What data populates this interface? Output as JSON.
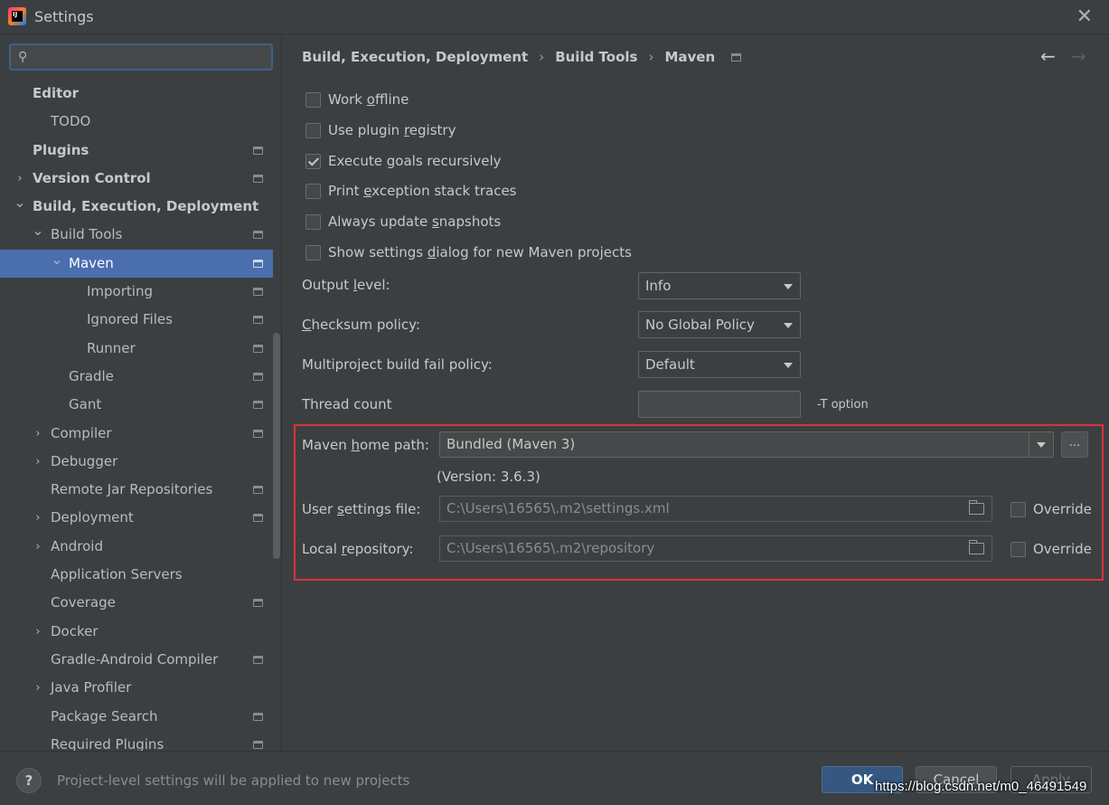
{
  "window": {
    "title": "Settings",
    "app_icon_text": "IJ",
    "close_glyph": "✕"
  },
  "search": {
    "placeholder": "",
    "icon_glyph": "⚲"
  },
  "sidebar": {
    "items": [
      {
        "label": "Editor",
        "bold": true,
        "level": 0,
        "arrow": "",
        "has_icon": false
      },
      {
        "label": "TODO",
        "bold": false,
        "level": 1,
        "arrow": "",
        "has_icon": false
      },
      {
        "label": "Plugins",
        "bold": true,
        "level": 0,
        "arrow": "",
        "has_icon": true
      },
      {
        "label": "Version Control",
        "bold": true,
        "level": 0,
        "arrow": "›",
        "has_icon": true
      },
      {
        "label": "Build, Execution, Deployment",
        "bold": true,
        "level": 0,
        "arrow": "⌄",
        "has_icon": false
      },
      {
        "label": "Build Tools",
        "bold": false,
        "level": 1,
        "arrow": "⌄",
        "has_icon": true
      },
      {
        "label": "Maven",
        "bold": false,
        "level": 2,
        "arrow": "⌄",
        "has_icon": true,
        "selected": true
      },
      {
        "label": "Importing",
        "bold": false,
        "level": 3,
        "arrow": "",
        "has_icon": true
      },
      {
        "label": "Ignored Files",
        "bold": false,
        "level": 3,
        "arrow": "",
        "has_icon": true
      },
      {
        "label": "Runner",
        "bold": false,
        "level": 3,
        "arrow": "",
        "has_icon": true
      },
      {
        "label": "Gradle",
        "bold": false,
        "level": 2,
        "arrow": "",
        "has_icon": true
      },
      {
        "label": "Gant",
        "bold": false,
        "level": 2,
        "arrow": "",
        "has_icon": true
      },
      {
        "label": "Compiler",
        "bold": false,
        "level": 1,
        "arrow": "›",
        "has_icon": true
      },
      {
        "label": "Debugger",
        "bold": false,
        "level": 1,
        "arrow": "›",
        "has_icon": false
      },
      {
        "label": "Remote Jar Repositories",
        "bold": false,
        "level": 1,
        "arrow": "",
        "has_icon": true
      },
      {
        "label": "Deployment",
        "bold": false,
        "level": 1,
        "arrow": "›",
        "has_icon": true
      },
      {
        "label": "Android",
        "bold": false,
        "level": 1,
        "arrow": "›",
        "has_icon": false
      },
      {
        "label": "Application Servers",
        "bold": false,
        "level": 1,
        "arrow": "",
        "has_icon": false
      },
      {
        "label": "Coverage",
        "bold": false,
        "level": 1,
        "arrow": "",
        "has_icon": true
      },
      {
        "label": "Docker",
        "bold": false,
        "level": 1,
        "arrow": "›",
        "has_icon": false
      },
      {
        "label": "Gradle-Android Compiler",
        "bold": false,
        "level": 1,
        "arrow": "",
        "has_icon": true
      },
      {
        "label": "Java Profiler",
        "bold": false,
        "level": 1,
        "arrow": "›",
        "has_icon": false
      },
      {
        "label": "Package Search",
        "bold": false,
        "level": 1,
        "arrow": "",
        "has_icon": true
      },
      {
        "label": "Required Plugins",
        "bold": false,
        "level": 1,
        "arrow": "",
        "has_icon": true
      }
    ]
  },
  "breadcrumb": {
    "parts": [
      "Build, Execution, Deployment",
      "Build Tools",
      "Maven"
    ],
    "separator": "›",
    "back_glyph": "←",
    "forward_glyph": "→"
  },
  "checkboxes": [
    {
      "pre": "Work ",
      "mn": "o",
      "post": "ffline",
      "checked": false
    },
    {
      "pre": "Use plugin ",
      "mn": "r",
      "post": "egistry",
      "checked": false
    },
    {
      "pre": "Execute ",
      "mn": "g",
      "post": "oals recursively",
      "checked": true
    },
    {
      "pre": "Print ",
      "mn": "e",
      "post": "xception stack traces",
      "checked": false
    },
    {
      "pre": "Always update ",
      "mn": "s",
      "post": "napshots",
      "checked": false
    },
    {
      "pre": "Show settings ",
      "mn": "d",
      "post": "ialog for new Maven projects",
      "checked": false
    }
  ],
  "form": {
    "output_level": {
      "pre": "Output ",
      "mn": "l",
      "post": "evel:",
      "value": "Info"
    },
    "checksum_policy": {
      "pre": "",
      "mn": "C",
      "post": "hecksum policy:",
      "value": "No Global Policy"
    },
    "fail_policy": {
      "label": "Multiproject build fail policy:",
      "value": "Default"
    },
    "thread_count": {
      "label": "Thread count",
      "value": "",
      "hint": "-T option"
    },
    "maven_home": {
      "pre": "Maven ",
      "mn": "h",
      "post": "ome path:",
      "value": "Bundled (Maven 3)",
      "browse": "...",
      "version": "(Version: 3.6.3)"
    },
    "user_settings": {
      "pre": "User ",
      "mn": "s",
      "post": "ettings file:",
      "value": "C:\\Users\\16565\\.m2\\settings.xml",
      "override": "Override",
      "override_checked": false
    },
    "local_repo": {
      "pre": "Local ",
      "mn": "r",
      "post": "epository:",
      "value": "C:\\Users\\16565\\.m2\\repository",
      "override": "Override",
      "override_checked": false
    }
  },
  "footer": {
    "help_glyph": "?",
    "note": "Project-level settings will be applied to new projects",
    "ok": "OK",
    "cancel": "Cancel",
    "apply": "Apply"
  },
  "watermark": "https://blog.csdn.net/m0_46491549",
  "colors": {
    "background": "#3c3f41",
    "selection": "#4b6eaf",
    "highlight_box": "#d9343a",
    "ok_button": "#365880"
  }
}
